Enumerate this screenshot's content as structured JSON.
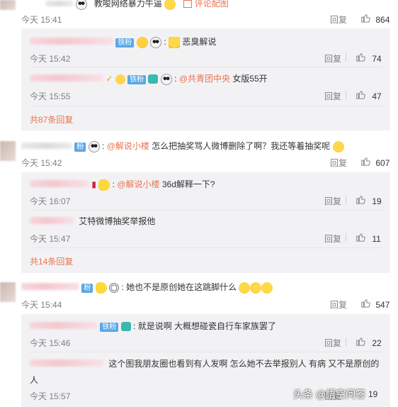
{
  "comments": [
    {
      "id": "c1",
      "text": "教唆网络暴力牛逼",
      "link_text": "评论配图",
      "time": "今天 15:41",
      "reply_label": "回复",
      "likes": "864",
      "subs": [
        {
          "id": "c1s1",
          "badge": "铁粉",
          "text": "恶臭解说",
          "time": "今天 15:42",
          "reply_label": "回复",
          "likes": "74"
        },
        {
          "id": "c1s2",
          "badge": "铁粉",
          "mention": "@共青团中央",
          "text": " 女版55开",
          "time": "今天 15:55",
          "reply_label": "回复",
          "likes": "47"
        }
      ],
      "more_replies": "共87条回复"
    },
    {
      "id": "c2",
      "badge": "粉",
      "mention": "@解说小楼",
      "text": " 怎么把抽奖骂人微博删除了啊？我还等着抽奖呢",
      "time": "今天 15:42",
      "reply_label": "回复",
      "likes": "607",
      "subs": [
        {
          "id": "c2s1",
          "mention": "@解说小楼",
          "text": " 36d解释一下?",
          "time": "今天 16:07",
          "reply_label": "回复",
          "likes": "19"
        },
        {
          "id": "c2s2",
          "text": "艾特微博抽奖举报他",
          "time": "今天 15:47",
          "reply_label": "回复",
          "likes": "11"
        }
      ],
      "more_replies": "共14条回复"
    },
    {
      "id": "c3",
      "badge": "粉",
      "text": "她也不是原创她在这跳脚什么",
      "time": "今天 15:44",
      "reply_label": "回复",
      "likes": "547",
      "subs": [
        {
          "id": "c3s1",
          "badge": "铁粉",
          "text": "就是说啊 大概想碰瓷自行车家族罢了",
          "time": "今天 15:46",
          "reply_label": "回复",
          "likes": "22"
        },
        {
          "id": "c3s2",
          "text_line1": "这个图我朋友圈也看到有人发啊 怎么她不去举报别人 有病 又不是原创的",
          "text_line2": "人",
          "time": "今天 15:57",
          "reply_label": "回复",
          "likes": "19"
        }
      ]
    }
  ],
  "watermark": "头条 @悟空问答",
  "colors": {
    "accent": "#eb7350",
    "badge": "#58a8e8",
    "sub_bg": "#f2f2f5",
    "meta": "#808080"
  }
}
